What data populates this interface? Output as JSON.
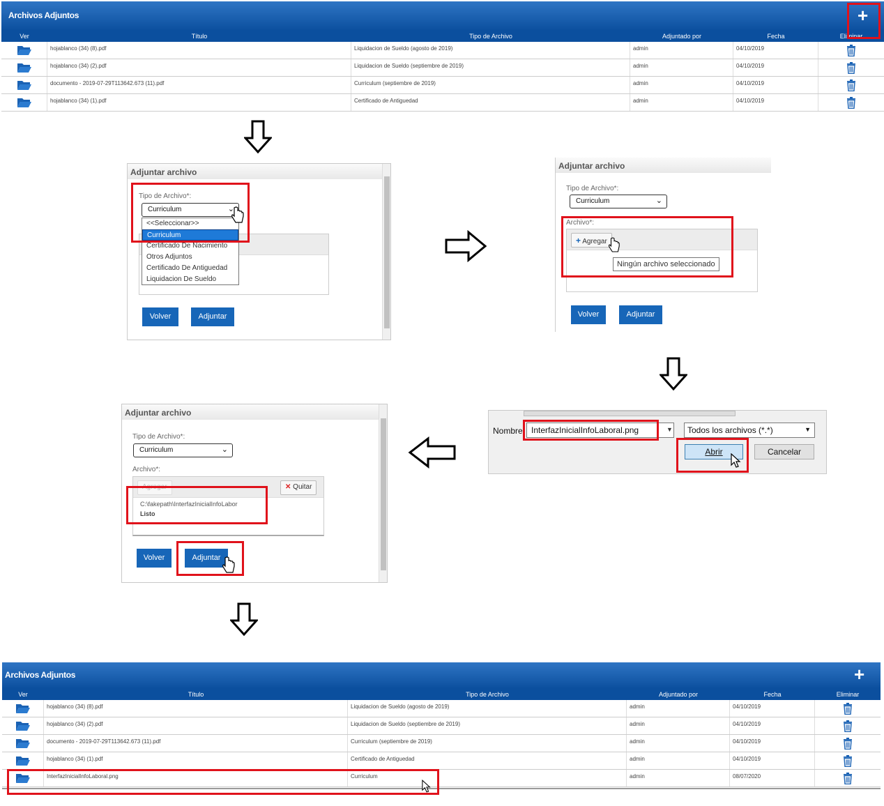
{
  "top_grid": {
    "title": "Archivos Adjuntos",
    "columns": [
      "Ver",
      "Título",
      "Tipo de Archivo",
      "Adjuntado por",
      "Fecha",
      "Eliminar"
    ],
    "rows": [
      {
        "titulo": "hojablanco (34) (8).pdf",
        "tipo": "Liquidacion de Sueldo (agosto de 2019)",
        "adjuntado_por": "admin",
        "fecha": "04/10/2019"
      },
      {
        "titulo": "hojablanco (34) (2).pdf",
        "tipo": "Liquidacion de Sueldo (septiembre de 2019)",
        "adjuntado_por": "admin",
        "fecha": "04/10/2019"
      },
      {
        "titulo": "documento - 2019-07-29T113642.673 (11).pdf",
        "tipo": "Curriculum (septiembre de 2019)",
        "adjuntado_por": "admin",
        "fecha": "04/10/2019"
      },
      {
        "titulo": "hojablanco (34) (1).pdf",
        "tipo": "Certificado de Antiguedad",
        "adjuntado_por": "admin",
        "fecha": "04/10/2019"
      }
    ]
  },
  "dialog1": {
    "title": "Adjuntar archivo",
    "tipo_label": "Tipo de Archivo*:",
    "selected": "Curriculum",
    "options": [
      "<<Seleccionar>>",
      "Curriculum",
      "Certificado De Nacimiento",
      "Otros Adjuntos",
      "Certificado De Antiguedad",
      "Liquidacion De Sueldo"
    ],
    "volver": "Volver",
    "adjuntar": "Adjuntar"
  },
  "dialog2": {
    "title": "Adjuntar archivo",
    "tipo_label": "Tipo de Archivo*:",
    "selected": "Curriculum",
    "archivo_label": "Archivo*:",
    "agregar": "Agregar",
    "tooltip": "Ningún archivo seleccionado",
    "volver": "Volver",
    "adjuntar": "Adjuntar"
  },
  "file_dialog": {
    "nombre_label": "Nombre:",
    "filename": "InterfazInicialInfoLaboral.png",
    "filter": "Todos los archivos (*.*)",
    "abrir": "Abrir",
    "cancelar": "Cancelar"
  },
  "dialog3": {
    "title": "Adjuntar archivo",
    "tipo_label": "Tipo de Archivo*:",
    "selected": "Curriculum",
    "archivo_label": "Archivo*:",
    "agregar": "Agregar",
    "quitar": "Quitar",
    "file_path": "C:\\fakepath\\InterfazInicialInfoLabor",
    "status": "Listo",
    "volver": "Volver",
    "adjuntar": "Adjuntar"
  },
  "bottom_grid": {
    "title": "Archivos Adjuntos",
    "columns": [
      "Ver",
      "Título",
      "Tipo de Archivo",
      "Adjuntado por",
      "Fecha",
      "Eliminar"
    ],
    "rows": [
      {
        "titulo": "hojablanco (34) (8).pdf",
        "tipo": "Liquidacion de Sueldo (agosto de 2019)",
        "adjuntado_por": "admin",
        "fecha": "04/10/2019"
      },
      {
        "titulo": "hojablanco (34) (2).pdf",
        "tipo": "Liquidacion de Sueldo (septiembre de 2019)",
        "adjuntado_por": "admin",
        "fecha": "04/10/2019"
      },
      {
        "titulo": "documento - 2019-07-29T113642.673 (11).pdf",
        "tipo": "Curriculum (septiembre de 2019)",
        "adjuntado_por": "admin",
        "fecha": "04/10/2019"
      },
      {
        "titulo": "hojablanco (34) (1).pdf",
        "tipo": "Certificado de Antiguedad",
        "adjuntado_por": "admin",
        "fecha": "04/10/2019"
      },
      {
        "titulo": "InterfazInicialInfoLaboral.png",
        "tipo": "Curriculum",
        "adjuntado_por": "admin",
        "fecha": "08/07/2020"
      }
    ]
  },
  "colors": {
    "header_blue": "#0b4f9e",
    "button_blue": "#1766b8",
    "highlight_red": "#e0121b",
    "folder_blue": "#1a62b4"
  }
}
